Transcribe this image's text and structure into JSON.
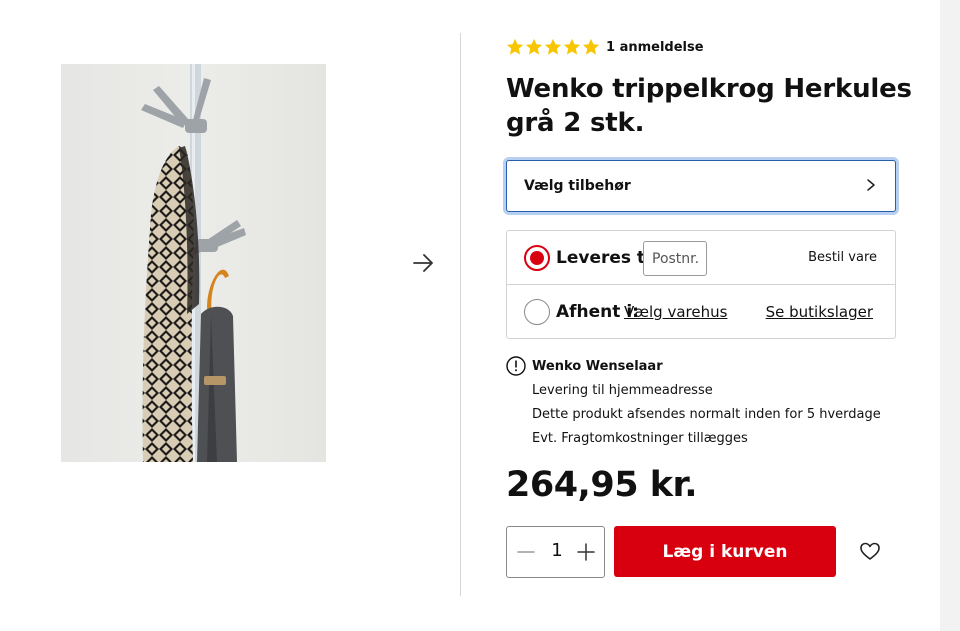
{
  "product": {
    "image_alt": "Wenko trippelkrog Herkules grå 2 stk. på stang med jakke og paraply",
    "review_count_label": "1 anmeldelse",
    "rating_stars": 5,
    "title": "Wenko trippelkrog Herkules grå 2 stk.",
    "price": "264,95 kr."
  },
  "accessory": {
    "label": "Vælg tilbehør"
  },
  "delivery": {
    "ship_label": "Leveres til:",
    "postnr_placeholder": "Postnr.",
    "order_label": "Bestil vare",
    "pickup_label": "Afhent i:",
    "store_select_label": "Vælg varehus",
    "store_stock_label": "Se butikslager"
  },
  "seller": {
    "name": "Wenko Wenselaar",
    "lines": [
      "Levering til hjemmeadresse",
      "Dette produkt afsendes normalt inden for 5 hverdage",
      "Evt. Fragtomkostninger tillægges"
    ]
  },
  "cart": {
    "quantity": "1",
    "add_label": "Læg i kurven"
  },
  "icons": {
    "next": "arrow-right-icon",
    "chevron": "chevron-right-icon",
    "info": "exclamation-circle-icon",
    "minus": "minus-icon",
    "plus": "plus-icon",
    "wishlist": "heart-icon",
    "star": "star-icon"
  },
  "colors": {
    "accent_red": "#d8000f",
    "star_yellow": "#f7c600",
    "focus_blue": "#2a5ea8"
  }
}
